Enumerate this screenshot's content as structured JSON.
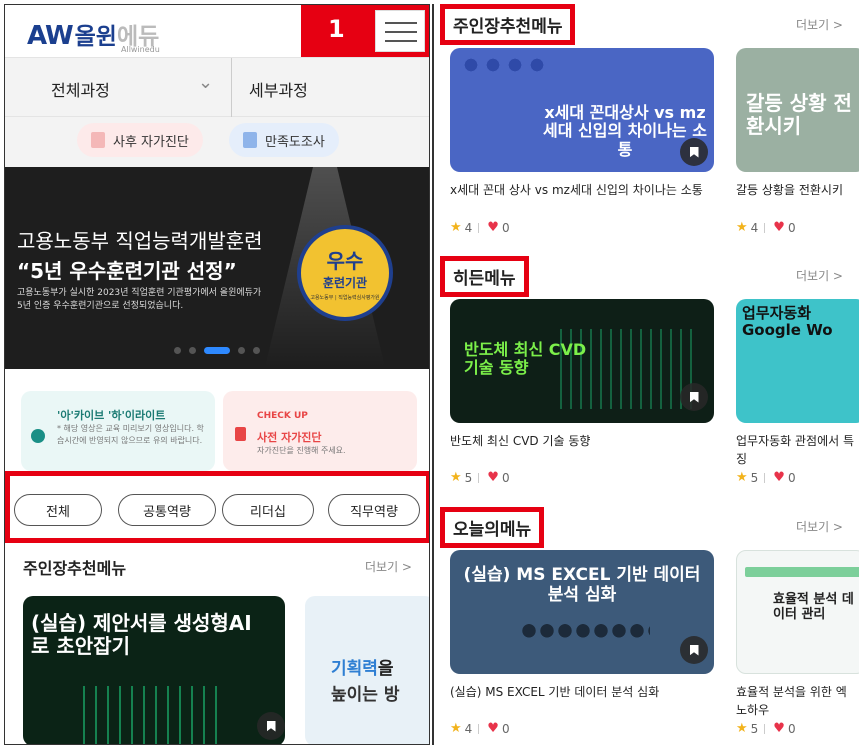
{
  "header": {
    "logo_aw": "AW",
    "logo_name": "올윈",
    "logo_name2": "에듀",
    "logo_sub": "Allwinedu",
    "badge_number": "1"
  },
  "filter": {
    "left_label": "전체과정",
    "right_label": "세부과정"
  },
  "pills": [
    "사후 자가진단",
    "만족도조사"
  ],
  "banner": {
    "line1": "고용노동부 직업능력개발훈련",
    "line2": "“5년 우수훈련기관 선정”",
    "line3": "고용노동부가 실시한 2023년 직업훈련 기관평가에서 올윈에듀가 5년 인증 우수훈련기관으로 선정되었습니다.",
    "badge_title": "우수",
    "badge_sub": "훈련기관",
    "badge_tiny": "고용노동부 | 직업능력심사평가원"
  },
  "info_cards": {
    "archive_title": "'아'카이브 '하'이라이트",
    "archive_desc": "* 해당 영상은 교육 미리보기 영상입니다. 학습시간에 반영되지 않으므로 유의 바랍니다.",
    "check_label": "CHECK UP",
    "check_title": "사전 자가진단",
    "check_desc": "자가진단을 진행해 주세요."
  },
  "categories": [
    "전체",
    "공통역량",
    "리더십",
    "직무역량"
  ],
  "left_section": {
    "title": "주인장추천메뉴",
    "more": "더보기 >",
    "thumb1_text": "(실습) 제안서를 생성형AI로 초안잡기",
    "thumb2_text_a": "기획력",
    "thumb2_text_b": "을",
    "thumb2_text_c": "높이는 방"
  },
  "right_sections": [
    {
      "label": "주인장추천메뉴",
      "more": "더보기 >",
      "cards": [
        {
          "thumb": "x세대 꼰대상사 vs mz세대 신입의 차이나는 소통",
          "title": "x세대 꼰대 상사 vs mz세대 신입의 차이나는 소통",
          "rating": "4",
          "likes": "0"
        },
        {
          "thumb": "갈등 상황 전환시키",
          "title": "갈등 상황을 전환시키",
          "rating": "4",
          "likes": "0"
        }
      ]
    },
    {
      "label": "히든메뉴",
      "more": "더보기 >",
      "cards": [
        {
          "thumb": "반도체 최신 CVD 기술 동향",
          "title": "반도체 최신 CVD 기술 동향",
          "rating": "5",
          "likes": "0"
        },
        {
          "thumb": "업무자동화 Google Wo",
          "title": "업무자동화 관점에서 특징",
          "rating": "5",
          "likes": "0"
        }
      ]
    },
    {
      "label": "오늘의메뉴",
      "more": "더보기 >",
      "cards": [
        {
          "thumb": "(실습) MS EXCEL 기반 데이터 분석 심화",
          "title": "(실습) MS EXCEL 기반 데이터 분석 심화",
          "rating": "4",
          "likes": "0"
        },
        {
          "thumb": "효율적 분석 데이터 관리",
          "title": "효율적 분석을 위한 엑 노하우",
          "rating": "5",
          "likes": "0"
        }
      ]
    }
  ]
}
